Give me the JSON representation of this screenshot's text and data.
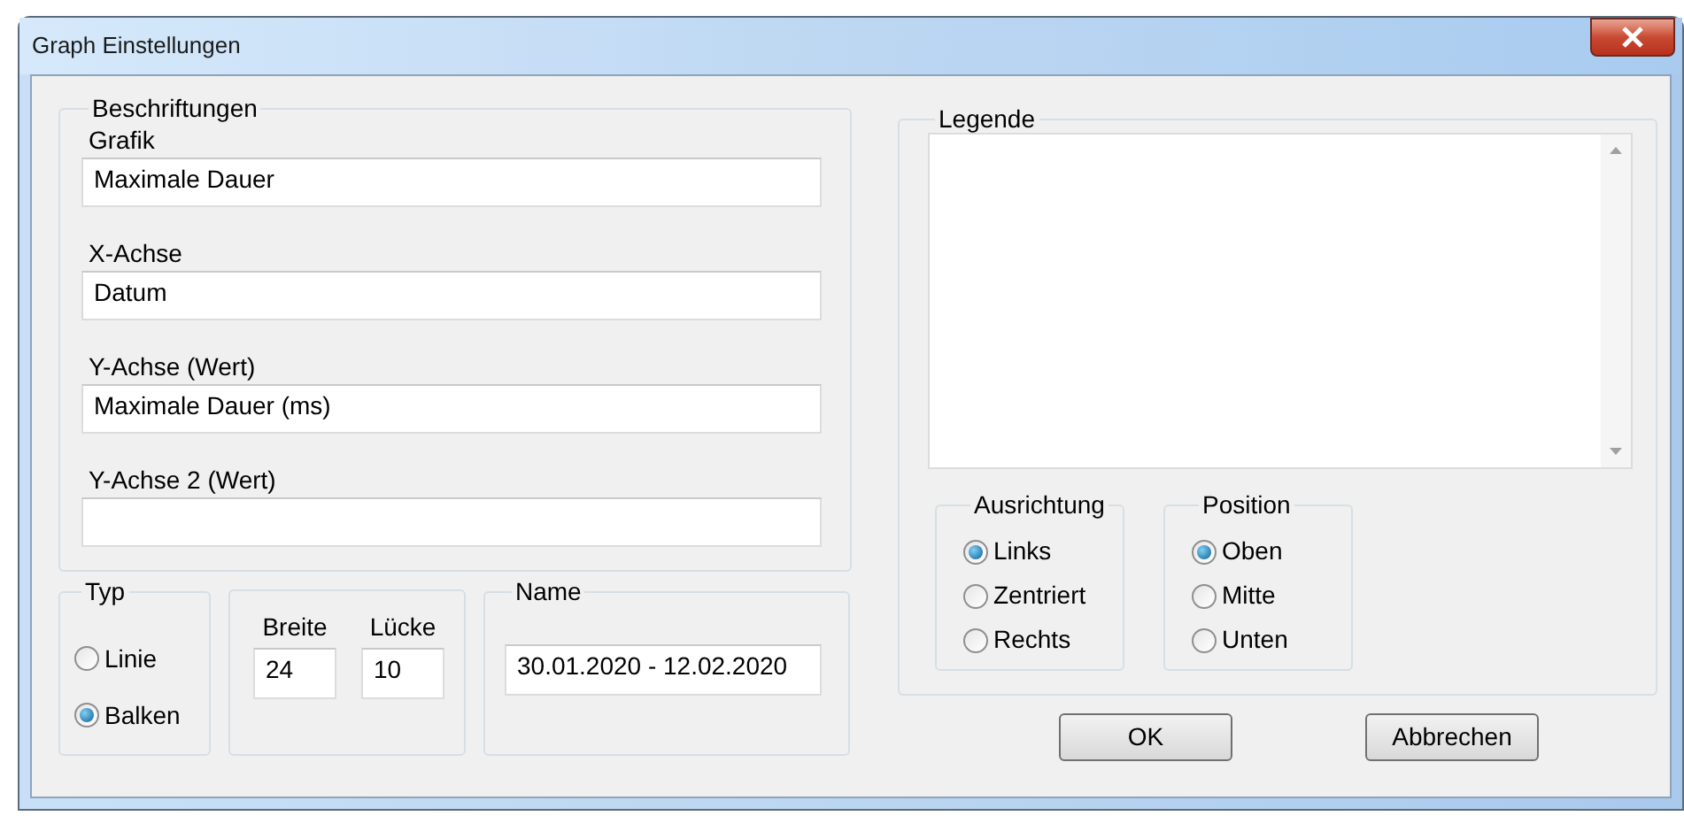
{
  "window": {
    "title": "Graph Einstellungen"
  },
  "labels_group": {
    "title": "Beschriftungen",
    "fields": [
      {
        "label": "Grafik",
        "value": "Maximale Dauer"
      },
      {
        "label": "X-Achse",
        "value": "Datum"
      },
      {
        "label": "Y-Achse (Wert)",
        "value": "Maximale Dauer (ms)"
      },
      {
        "label": "Y-Achse 2 (Wert)"
      }
    ]
  },
  "type_group": {
    "title": "Typ",
    "options": [
      {
        "label": "Linie",
        "selected": false
      },
      {
        "label": "Balken",
        "selected": true
      }
    ]
  },
  "size_group": {
    "fields": [
      {
        "label": "Breite",
        "value": "24"
      },
      {
        "label": "Lücke",
        "value": "10"
      }
    ]
  },
  "name_group": {
    "title": "Name",
    "value": "30.01.2020 - 12.02.2020"
  },
  "legend_group": {
    "title": "Legende",
    "alignment": {
      "title": "Ausrichtung",
      "options": [
        {
          "label": "Links",
          "selected": true
        },
        {
          "label": "Zentriert",
          "selected": false
        },
        {
          "label": "Rechts",
          "selected": false
        }
      ]
    },
    "position": {
      "title": "Position",
      "options": [
        {
          "label": "Oben",
          "selected": true
        },
        {
          "label": "Mitte",
          "selected": false
        },
        {
          "label": "Unten",
          "selected": false
        }
      ]
    }
  },
  "buttons": [
    "OK",
    "Abbrechen"
  ]
}
